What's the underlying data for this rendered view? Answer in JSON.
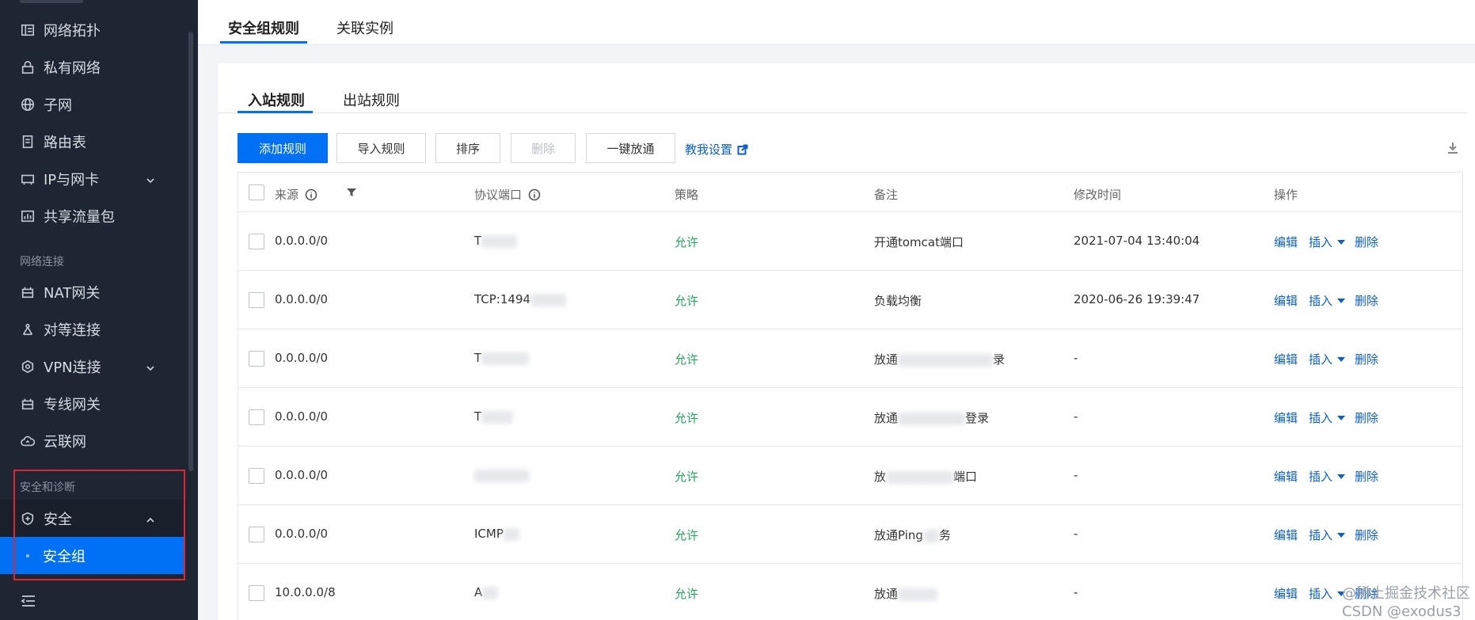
{
  "sidebar": {
    "items": [
      {
        "label": "网络拓扑",
        "icon": "topology-icon"
      },
      {
        "label": "私有网络",
        "icon": "lock-icon"
      },
      {
        "label": "子网",
        "icon": "globe-icon"
      },
      {
        "label": "路由表",
        "icon": "document-icon"
      },
      {
        "label": "IP与网卡",
        "icon": "ip-card-icon"
      },
      {
        "label": "共享流量包",
        "icon": "chart-icon"
      }
    ],
    "section_network": "网络连接",
    "items2": [
      {
        "label": "NAT网关",
        "icon": "gateway-icon"
      },
      {
        "label": "对等连接",
        "icon": "peering-icon"
      },
      {
        "label": "VPN连接",
        "icon": "vpn-icon"
      },
      {
        "label": "专线网关",
        "icon": "gateway-icon"
      },
      {
        "label": "云联网",
        "icon": "cloud-icon"
      }
    ],
    "section_security": "安全和诊断",
    "security_label": "安全",
    "security_group_label": "安全组"
  },
  "top_tabs": [
    "安全组规则",
    "关联实例"
  ],
  "sub_tabs": [
    "入站规则",
    "出站规则"
  ],
  "toolbar": {
    "add": "添加规则",
    "import": "导入规则",
    "sort": "排序",
    "delete": "删除",
    "open_all": "一键放通",
    "teach": "教我设置"
  },
  "table": {
    "headers": [
      "来源",
      "协议端口",
      "策略",
      "备注",
      "修改时间",
      "操作"
    ],
    "rows": [
      {
        "source": "0.0.0.0/0",
        "port": "T",
        "policy": "允许",
        "note": "开通tomcat端口",
        "time": "2021-07-04 13:40:04"
      },
      {
        "source": "0.0.0.0/0",
        "port": "TCP:1494",
        "policy": "允许",
        "note": "负载均衡",
        "time": "2020-06-26 19:39:47"
      },
      {
        "source": "0.0.0.0/0",
        "port": "T",
        "policy": "允许",
        "note": "放通",
        "note_tail": "录",
        "time": "-"
      },
      {
        "source": "0.0.0.0/0",
        "port": "T",
        "policy": "允许",
        "note": "放通",
        "note_tail": "登录",
        "time": "-"
      },
      {
        "source": "0.0.0.0/0",
        "port": "",
        "policy": "允许",
        "note": "放",
        "note_tail": "端口",
        "time": "-"
      },
      {
        "source": "0.0.0.0/0",
        "port": "ICMP",
        "policy": "允许",
        "note": "放通Ping",
        "note_tail": "务",
        "time": "-"
      },
      {
        "source": "10.0.0.0/8",
        "port": "A",
        "policy": "允许",
        "note": "放通",
        "note_tail": "",
        "time": "-"
      }
    ],
    "ops": {
      "edit": "编辑",
      "insert": "插入",
      "delete": "删除"
    }
  },
  "watermark": {
    "line1": "@稀土掘金技术社区",
    "line2": "CSDN @exodus3"
  }
}
